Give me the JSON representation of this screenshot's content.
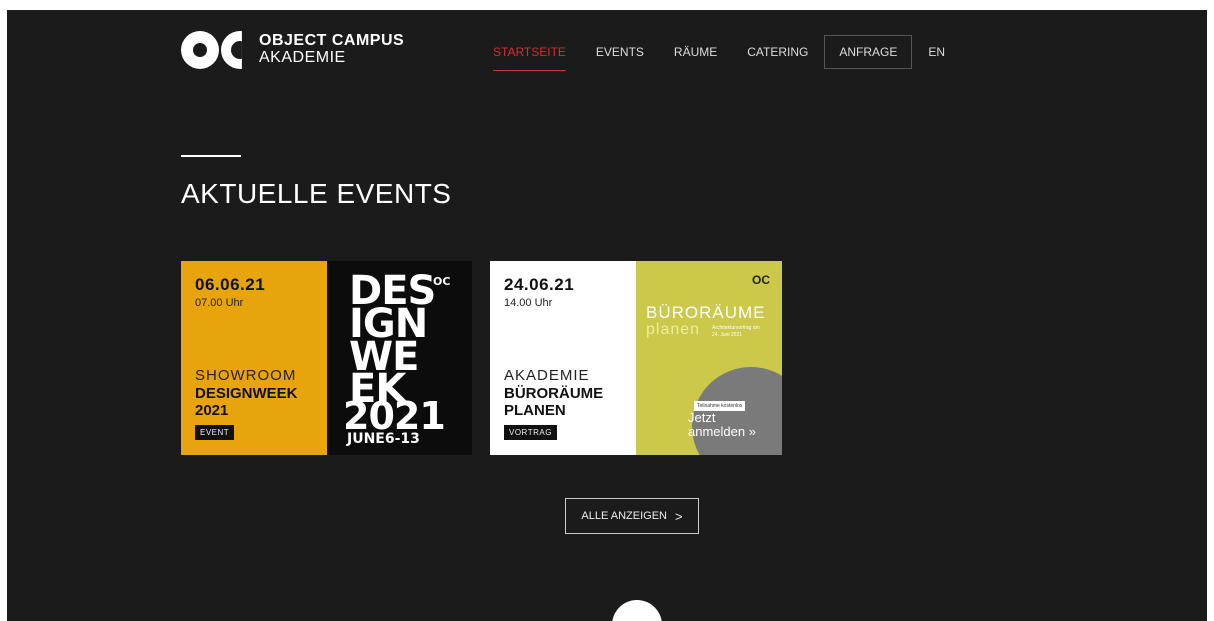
{
  "brand": {
    "line1": "OBJECT CAMPUS",
    "line2": "AKADEMIE"
  },
  "nav": {
    "items": [
      {
        "label": "STARTSEITE"
      },
      {
        "label": "EVENTS"
      },
      {
        "label": "RÄUME"
      },
      {
        "label": "CATERING"
      }
    ],
    "cta_label": "ANFRAGE",
    "lang_label": "EN"
  },
  "section": {
    "title": "AKTUELLE EVENTS"
  },
  "events": [
    {
      "date": "06.06.21",
      "time": "07.00 Uhr",
      "title_light": "SHOWROOM",
      "title_bold_1": "DESIGNWEEK",
      "title_bold_2": "2021",
      "tag": "EVENT",
      "poster": {
        "line1": "DES",
        "line2": "IGN",
        "line3": "WE",
        "line4": "EK",
        "year": "2021",
        "sub": "JUNE6-13",
        "mark": "OC"
      }
    },
    {
      "date": "24.06.21",
      "time": "14.00 Uhr",
      "title_light": "AKADEMIE",
      "title_bold_1": "BÜRORÄUME",
      "title_bold_2": "PLANEN",
      "tag": "VORTRAG",
      "poster": {
        "mark": "OC",
        "title": "BÜRORÄUME",
        "sub": "planen",
        "small": "Architekturvortrag am 24. Juni 2021",
        "badge": "Teilnahme kostenlos",
        "cta_1": "Jetzt",
        "cta_2": "anmelden »"
      }
    }
  ],
  "more_button": {
    "label": "ALLE ANZEIGEN",
    "arrow": ">"
  },
  "colors": {
    "background": "#1b1b1b",
    "accent": "#d32f2f",
    "card1": "#e8a40c",
    "card2": "#cbc84a"
  }
}
